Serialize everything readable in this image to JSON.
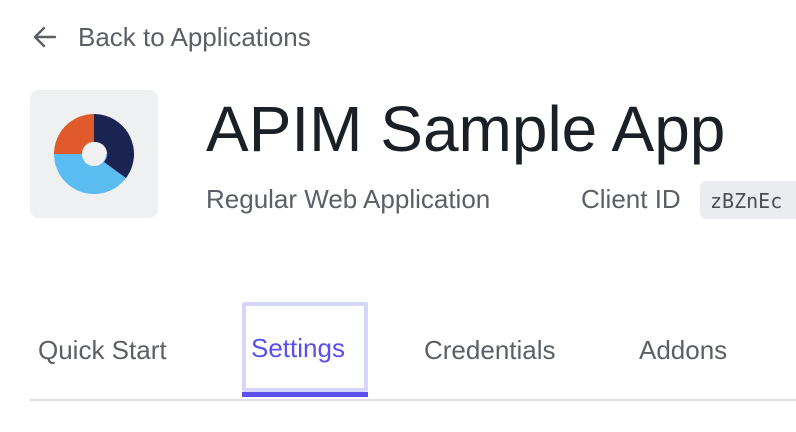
{
  "nav": {
    "back_label": "Back to Applications",
    "back_icon": "arrow-left-icon"
  },
  "app": {
    "name": "APIM Sample App",
    "type": "Regular Web Application",
    "client_id_label": "Client ID",
    "client_id_value": "zBZnEc",
    "logo_icon": "app-logo-icon",
    "logo_colors": {
      "orange": "#e05a2b",
      "navy": "#1a2351",
      "light_blue": "#5bbcf1",
      "tile_bg": "#eef0f2"
    }
  },
  "tabs": [
    {
      "label": "Quick Start",
      "active": false
    },
    {
      "label": "Settings",
      "active": true
    },
    {
      "label": "Credentials",
      "active": false
    },
    {
      "label": "Addons",
      "active": false
    }
  ],
  "colors": {
    "accent": "#5b4ff0",
    "focus_ring": "#d8d5fb",
    "text_muted": "#5c6066",
    "text_primary": "#1b1f26"
  }
}
